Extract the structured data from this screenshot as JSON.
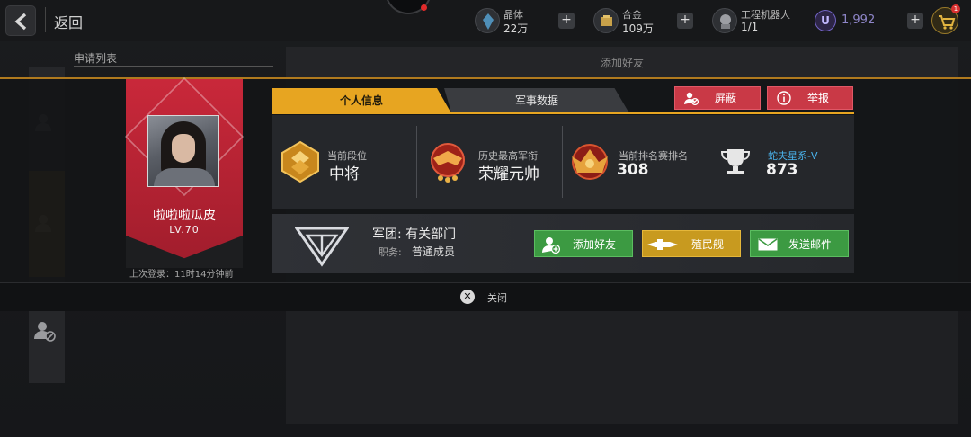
{
  "topbar": {
    "back_label": "返回",
    "resources": [
      {
        "icon": "crystal-icon",
        "label": "晶体",
        "value": "22万"
      },
      {
        "icon": "alloy-icon",
        "label": "合金",
        "value": "109万"
      },
      {
        "icon": "robot-icon",
        "label": "工程机器人",
        "value": "1/1"
      }
    ],
    "u_currency": {
      "icon": "u-coin-icon",
      "glyph": "U",
      "value": "1,992"
    },
    "cart_badge": "1"
  },
  "background": {
    "list_header": "申请列表",
    "right_header": "添加好友"
  },
  "profile": {
    "name": "啦啦啦瓜皮",
    "level": "LV.70",
    "last_login": "上次登录：11时14分钟前",
    "banner_color": "#c9283a"
  },
  "tabs": [
    {
      "label": "个人信息",
      "active": true
    },
    {
      "label": "军事数据",
      "active": false
    }
  ],
  "actions": {
    "block_label": "屏蔽",
    "report_label": "举报"
  },
  "stats": [
    {
      "label": "当前段位",
      "value": "中将",
      "icon": "rank-badge-icon"
    },
    {
      "label": "历史最高军衔",
      "value": "荣耀元帅",
      "icon": "marshal-badge-icon"
    },
    {
      "label": "当前排名赛排名",
      "value": "308",
      "icon": "ranking-badge-icon"
    },
    {
      "label": "蛇夫星系-V",
      "value": "873",
      "icon": "trophy-icon"
    }
  ],
  "legion": {
    "name": "军团: 有关部门",
    "role_label": "职务:",
    "role": "普通成员"
  },
  "buttons": {
    "add_friend": "添加好友",
    "colony_ship": "殖民舰",
    "send_mail": "发送邮件"
  },
  "close_label": "关闭",
  "colors": {
    "accent": "#e7a521",
    "danger": "#c93946",
    "success": "#3c9a42",
    "gold": "#c89a1f"
  }
}
